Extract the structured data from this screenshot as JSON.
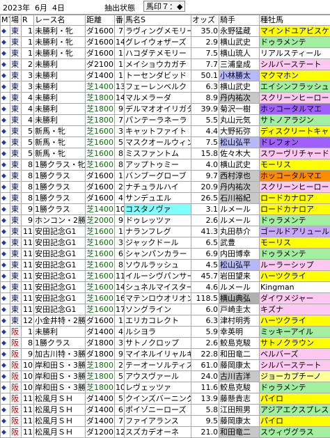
{
  "topbar": {
    "date": "2023年  6月  4日",
    "extract_label": "抽出状態",
    "mark_label": "馬印７：◆"
  },
  "headers": [
    "M7",
    "場",
    "R",
    "レース名",
    "距離",
    "番",
    "馬名S",
    "オッズ",
    "騎手",
    "種牡馬"
  ],
  "rows": [
    {
      "venue": "東",
      "r": "1",
      "race": "未勝利・牝",
      "dist": "ダ1600",
      "num": "7",
      "horse": "ラヴィングメモリー",
      "odds": "35.0",
      "jockey": "永野猛蔵",
      "sire": "マインドユアビスケッ"
    },
    {
      "venue": "東",
      "r": "1",
      "race": "未勝利・牝",
      "dist": "ダ1600",
      "num": "14",
      "horse": "グレイウォザーズ",
      "odds": "2.9",
      "jockey": "横山武史",
      "sire": "ドゥラメンテ"
    },
    {
      "venue": "東",
      "r": "1",
      "race": "未勝利・牝",
      "dist": "ダ1600",
      "num": "1",
      "horse": "ハコダテメモリー",
      "odds": "7.5",
      "jockey": "横山琉人",
      "sire": "リアルスティール"
    },
    {
      "venue": "東",
      "r": "2",
      "race": "未勝利",
      "dist": "ダ2100",
      "num": "1",
      "horse": "メイショウカガチ",
      "odds": "7.7",
      "jockey": "三浦皇成",
      "sire": "シルバーステート"
    },
    {
      "venue": "東",
      "r": "3",
      "race": "未勝利",
      "dist": "ダ1400",
      "num": "1",
      "horse": "トーセンダビッド",
      "odds": "50.1",
      "jockey": "小林勝太",
      "sire": "マクマホン"
    },
    {
      "venue": "東",
      "r": "3",
      "race": "未勝利",
      "dist": "芝1400",
      "num": "13",
      "horse": "フェーレンベルク",
      "odds": "6.3",
      "jockey": "横山武史",
      "sire": "エイシンフラッシュ"
    },
    {
      "venue": "東",
      "r": "4",
      "race": "未勝利",
      "dist": "芝1800",
      "num": "14",
      "horse": "マルメラーダ",
      "odds": "8.9",
      "jockey": "丹内祐次",
      "sire": "スクリーンヒーロー"
    },
    {
      "venue": "東",
      "r": "4",
      "race": "未勝利",
      "dist": "芝1800",
      "num": "9",
      "horse": "デルマオオイリガタ",
      "odds": "39.9",
      "jockey": "菊沢一樹",
      "sire": "ホッコータルマエ"
    },
    {
      "venue": "東",
      "r": "4",
      "race": "未勝利",
      "dist": "芝1800",
      "num": "7",
      "horse": "パンテーラネーラ",
      "odds": "5.5",
      "jockey": "丸山元気",
      "sire": "サトノアラジン"
    },
    {
      "venue": "東",
      "r": "5",
      "race": "新馬・牝",
      "dist": "芝1600",
      "num": "3",
      "horse": "キャットファイト",
      "odds": "4.4",
      "jockey": "大野拓弥",
      "sire": "ディスクリートキャット"
    },
    {
      "venue": "東",
      "r": "5",
      "race": "新馬・牝",
      "dist": "芝1600",
      "num": "5",
      "horse": "マスクオールウィン",
      "odds": "7.5",
      "jockey": "松山弘平",
      "sire": "ドレフォン"
    },
    {
      "venue": "東",
      "r": "5",
      "race": "新馬・牝",
      "dist": "芝1600",
      "num": "8",
      "horse": "ミスファントム",
      "odds": "15.8",
      "jockey": "佐々木大",
      "sire": "スワーヴリチャード"
    },
    {
      "venue": "東",
      "r": "8",
      "race": "1勝クラス・牝",
      "dist": "芝1600",
      "num": "8",
      "horse": "アップトゥミー",
      "odds": "4.0",
      "jockey": "横山武史",
      "sire": "モーリス"
    },
    {
      "venue": "東",
      "r": "8",
      "race": "1勝クラス",
      "dist": "ダ1600",
      "num": "1",
      "horse": "バンブーグローブ",
      "odds": "9.7",
      "jockey": "西村淳也",
      "sire": "ホッコータルマエ"
    },
    {
      "venue": "東",
      "r": "8",
      "race": "1勝クラス",
      "dist": "ダ1600",
      "num": "2",
      "horse": "ナチュラルハイ",
      "odds": "20.9",
      "jockey": "丹内祐次",
      "sire": "スクリーンヒーロー"
    },
    {
      "venue": "東",
      "r": "8",
      "race": "1勝クラス",
      "dist": "ダ1600",
      "num": "4",
      "horse": "サンデュエル",
      "odds": "26.5",
      "jockey": "石川裕紀",
      "sire": "ロードカナロア"
    },
    {
      "venue": "東",
      "r": "9",
      "race": "1勝クラス",
      "dist": "芝1400",
      "num": "10",
      "horse": "コスタノヴァ",
      "odds": "3.1",
      "jockey": "ルメール",
      "sire": "ロードカナロア"
    },
    {
      "venue": "東",
      "r": "9",
      "race": "ホンコン・2勝",
      "dist": "芝2000",
      "num": "9",
      "horse": "ドゥレッツァ",
      "odds": "2.6",
      "jockey": "ルメール",
      "sire": "ドゥラメンテ"
    },
    {
      "venue": "東",
      "r": "11",
      "race": "安田記念G1",
      "dist": "芝1600",
      "num": "1",
      "horse": "ナランフレグ",
      "odds": "41.3",
      "jockey": "丸田恭介",
      "sire": "ゴールドアリュール"
    },
    {
      "venue": "東",
      "r": "11",
      "race": "安田記念G1",
      "dist": "芝1600",
      "num": "3",
      "horse": "ジャックドール",
      "odds": "6.5",
      "jockey": "武豊",
      "sire": "モーリス"
    },
    {
      "venue": "東",
      "r": "11",
      "race": "安田記念G1",
      "dist": "芝1600",
      "num": "6",
      "horse": "シャンパンカラー",
      "odds": "6.9",
      "jockey": "内田博幸",
      "sire": "ドゥラメンテ"
    },
    {
      "venue": "東",
      "r": "11",
      "race": "安田記念G1",
      "dist": "芝1600",
      "num": "8",
      "horse": "ソウルラッシュ",
      "odds": "4.5",
      "jockey": "松山弘平",
      "sire": "ルーラーシップ"
    },
    {
      "venue": "東",
      "r": "11",
      "race": "安田記念G1",
      "dist": "芝1600",
      "num": "11",
      "horse": "イルーシヴパンサー",
      "odds": "45.7",
      "jockey": "岩田望来",
      "sire": "ハーツクライ"
    },
    {
      "venue": "東",
      "r": "11",
      "race": "安田記念G1",
      "dist": "芝1600",
      "num": "14",
      "horse": "シュネルマイスター",
      "odds": "4.6",
      "jockey": "ルメール",
      "sire": "Kingman"
    },
    {
      "venue": "東",
      "r": "11",
      "race": "安田記念G1",
      "dist": "芝1600",
      "num": "16",
      "horse": "マテンロウオリオン",
      "odds": "118.5",
      "jockey": "横山典弘",
      "sire": "ダイワメジャー"
    },
    {
      "venue": "東",
      "r": "11",
      "race": "安田記念G1",
      "dist": "芝1600",
      "num": "17",
      "horse": "ソングライン",
      "odds": "6.0",
      "jockey": "戸崎圭太",
      "sire": "キズナ"
    },
    {
      "venue": "東",
      "r": "12",
      "race": "小金井特・2勝",
      "dist": "ダ1600",
      "num": "1",
      "horse": "エリカコレクト",
      "odds": "6.3",
      "jockey": "津村明秀",
      "sire": "ハーツクライ"
    },
    {
      "venue": "阪",
      "r": "1",
      "race": "未勝利",
      "dist": "ダ1400",
      "num": "4",
      "horse": "ルシヨラ",
      "odds": "5.9",
      "jockey": "幸英明",
      "sire": "ミッキーアイル"
    },
    {
      "venue": "阪",
      "r": "8",
      "race": "1勝クラス",
      "dist": "ダ1800",
      "num": "3",
      "horse": "サトノクロップ",
      "odds": "2.6",
      "jockey": "鮫島克駿",
      "sire": "サトノクラウン"
    },
    {
      "venue": "阪",
      "r": "9",
      "race": "加古川特・3勝",
      "dist": "ダ1800",
      "num": "9",
      "horse": "マイネルイリャルギ",
      "odds": "22.8",
      "jockey": "和田竜二",
      "sire": "ベルバーズ"
    },
    {
      "venue": "阪",
      "r": "10",
      "race": "岸和田Ｓ・3勝",
      "dist": "芝1800",
      "num": "2",
      "horse": "テーオーソルティス",
      "odds": "61.0",
      "jockey": "藤岡康太",
      "sire": "シルバーステート"
    },
    {
      "venue": "阪",
      "r": "10",
      "race": "岸和田Ｓ・3勝",
      "dist": "芝1800",
      "num": "5",
      "horse": "アウスヴァール",
      "odds": "24.0",
      "jockey": "古川吉洋",
      "sire": "ジョーカプチーノ"
    },
    {
      "venue": "阪",
      "r": "10",
      "race": "岸和田Ｓ・3勝",
      "dist": "芝1800",
      "num": "10",
      "horse": "レヴェッツァ",
      "odds": "11.6",
      "jockey": "鮫島克駿",
      "sire": "ドゥラメンテ"
    },
    {
      "venue": "阪",
      "r": "11",
      "race": "松風月ＳＨ",
      "dist": "ダ1400",
      "num": "5",
      "horse": "クインズバーニング",
      "odds": "13.9",
      "jockey": "藤懸貴志",
      "sire": "パイロ"
    },
    {
      "venue": "阪",
      "r": "11",
      "race": "松風月ＳＨ",
      "dist": "ダ1400",
      "num": "6",
      "horse": "ポイゾニーローズ",
      "odds": "5.8",
      "jockey": "江田照男",
      "sire": "アジアエクスプレス"
    },
    {
      "venue": "阪",
      "r": "11",
      "race": "松風月ＳＨ",
      "dist": "ダ1400",
      "num": "7",
      "horse": "ファイアランス",
      "odds": "9.5",
      "jockey": "藤岡康太",
      "sire": "パイロ"
    },
    {
      "venue": "阪",
      "r": "11",
      "race": "松風月ＳＨ",
      "dist": "ダ1200",
      "num": "12",
      "horse": "スズカデオーネ",
      "odds": "21.0",
      "jockey": "和田竜二",
      "sire": "スウィヴグラス"
    }
  ],
  "colors": {
    "east": "#0000c8",
    "west": "#c00000",
    "turf": "#0a6e0a"
  }
}
